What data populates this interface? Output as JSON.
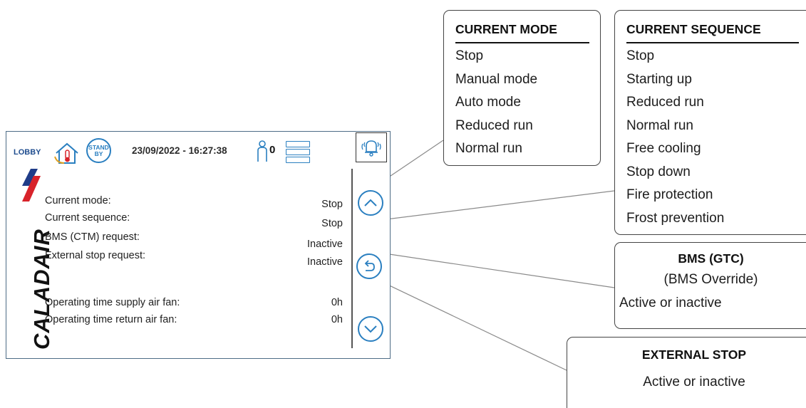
{
  "header": {
    "location": "LOBBY",
    "standby_line1": "STAND",
    "standby_line2": "BY",
    "datetime": "23/09/2022 - 16:27:38",
    "occupancy_count": "0",
    "icons": [
      "home-thermometer-icon",
      "standby-button",
      "occupant-icon",
      "stack-icon",
      "alarm-bell-icon"
    ]
  },
  "brand": {
    "logo_text": "CALADAIR",
    "colors": {
      "red": "#d8232a",
      "navy": "#1f3c88",
      "accent_blue": "#2a7fc0"
    }
  },
  "status": [
    {
      "label": "Current mode:",
      "value": "Stop"
    },
    {
      "label": "Current sequence:",
      "value": "Stop"
    },
    {
      "label": "BMS (CTM) request:",
      "value": "Inactive"
    },
    {
      "label": "External stop request:",
      "value": "Inactive"
    },
    {
      "label": "Operating time supply air fan:",
      "value": "0h"
    },
    {
      "label": "Operating time return air fan:",
      "value": "0h"
    }
  ],
  "nav": {
    "icons": [
      "chevron-up-icon",
      "back-icon",
      "chevron-down-icon"
    ]
  },
  "callouts": {
    "current_mode": {
      "title": "CURRENT MODE",
      "items": [
        "Stop",
        "Manual mode",
        "Auto mode",
        "Reduced run",
        "Normal run"
      ]
    },
    "current_sequence": {
      "title": "CURRENT SEQUENCE",
      "items": [
        "Stop",
        "Starting up",
        "Reduced run",
        "Normal run",
        "Free cooling",
        "Stop down",
        "Fire protection",
        "Frost prevention"
      ]
    },
    "bms": {
      "title": "BMS (GTC)",
      "subtitle": "(BMS Override)",
      "text": "Active or inactive"
    },
    "external_stop": {
      "title": "EXTERNAL STOP",
      "text": "Active or inactive"
    }
  }
}
